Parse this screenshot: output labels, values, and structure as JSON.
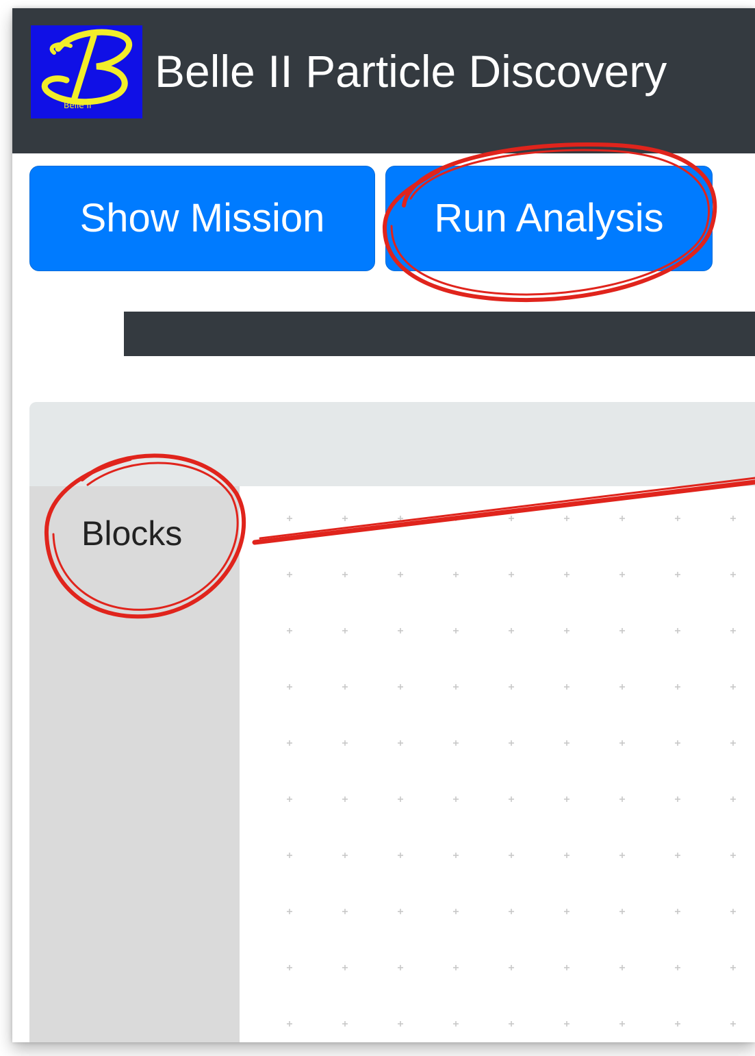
{
  "app": {
    "title": "Belle II Particle Discovery",
    "logo_letter": "B",
    "logo_caption": "Belle II"
  },
  "toolbar": {
    "show_mission_label": "Show Mission",
    "run_analysis_label": "Run Analysis"
  },
  "toolbox": {
    "categories": [
      {
        "label": "Blocks"
      }
    ]
  },
  "colors": {
    "navbar": "#343a40",
    "button": "#007bff",
    "logo_background": "#1010e6",
    "logo_glyph": "#f2ee2a",
    "workspace_header": "#e4e8e9",
    "toolbox": "#dadada",
    "grid_mark": "#c8c8c8",
    "annotation": "#e0241c"
  },
  "icons": {
    "logo": "belle-ii-logo-icon",
    "grid_mark": "plus-mark-icon"
  }
}
